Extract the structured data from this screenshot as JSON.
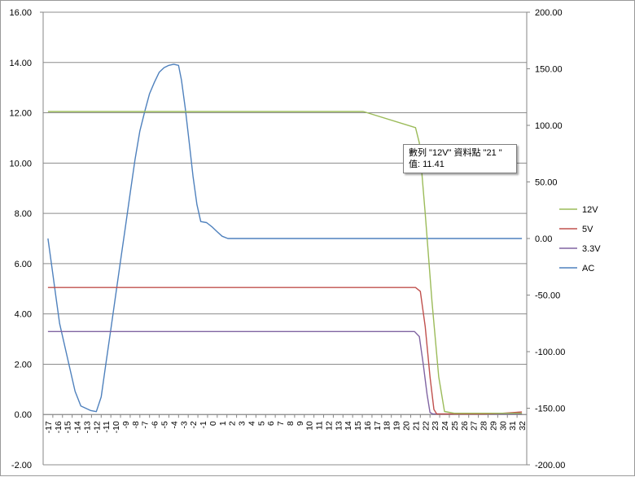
{
  "chart_data": {
    "type": "line",
    "title": "",
    "xlabel": "",
    "ylabel": "",
    "x_categories": [
      "-17",
      "-16",
      "-15",
      "-14",
      "-13",
      "-12",
      "-11",
      "-10",
      "-9",
      "-8",
      "-7",
      "-6",
      "-5",
      "-4",
      "-3",
      "-2",
      "-1",
      "0",
      "1",
      "2",
      "3",
      "4",
      "5",
      "6",
      "7",
      "8",
      "9",
      "10",
      "11",
      "12",
      "13",
      "14",
      "15",
      "16",
      "17",
      "18",
      "19",
      "20",
      "21",
      "22",
      "23",
      "24",
      "25",
      "26",
      "27",
      "28",
      "29",
      "30",
      "31",
      "32"
    ],
    "y_primary": {
      "min": -2,
      "max": 16,
      "step": 2,
      "tick_labels": [
        "16.00",
        "14.00",
        "12.00",
        "10.00",
        "8.00",
        "6.00",
        "4.00",
        "2.00",
        "0.00",
        "-2.00"
      ]
    },
    "y_secondary": {
      "min": -200,
      "max": 200,
      "step": 50,
      "tick_labels": [
        "200.00",
        "150.00",
        "100.00",
        "50.00",
        "0.00",
        "-50.00",
        "-100.00",
        "-150.00",
        "-200.00"
      ]
    },
    "grid": "horizontal",
    "legend_position": "right",
    "series": [
      {
        "name": "12V",
        "axis": "primary",
        "color": "#9bbb59",
        "points": [
          [
            -17,
            12.05
          ],
          [
            15.6,
            12.05
          ],
          [
            21,
            11.41
          ],
          [
            21.4,
            10.8
          ],
          [
            22,
            8.0
          ],
          [
            22.7,
            4.5
          ],
          [
            23.4,
            1.5
          ],
          [
            24,
            0.12
          ],
          [
            25,
            0.05
          ],
          [
            32,
            0.05
          ]
        ]
      },
      {
        "name": "5V",
        "axis": "primary",
        "color": "#c0504d",
        "points": [
          [
            -17,
            5.05
          ],
          [
            21,
            5.05
          ],
          [
            21.5,
            4.9
          ],
          [
            22,
            3.5
          ],
          [
            22.5,
            1.5
          ],
          [
            22.9,
            0.2
          ],
          [
            23.2,
            0.02
          ],
          [
            28,
            0.02
          ],
          [
            30,
            0.05
          ],
          [
            32,
            0.1
          ]
        ]
      },
      {
        "name": "3.3V",
        "axis": "primary",
        "color": "#8064a2",
        "points": [
          [
            -17,
            3.3
          ],
          [
            20.9,
            3.3
          ],
          [
            21.4,
            3.1
          ],
          [
            21.8,
            2.0
          ],
          [
            22.2,
            0.8
          ],
          [
            22.5,
            0.08
          ],
          [
            22.8,
            0.02
          ],
          [
            32,
            0.02
          ]
        ]
      },
      {
        "name": "AC",
        "axis": "secondary",
        "color": "#4f81bd",
        "points": [
          [
            -17,
            0
          ],
          [
            -16.6,
            -25
          ],
          [
            -16.2,
            -50
          ],
          [
            -15.8,
            -75
          ],
          [
            -15,
            -105
          ],
          [
            -14.2,
            -135
          ],
          [
            -13.6,
            -148
          ],
          [
            -12.6,
            -152
          ],
          [
            -12,
            -153
          ],
          [
            -11.5,
            -140
          ],
          [
            -11,
            -110
          ],
          [
            -10.5,
            -80
          ],
          [
            -10,
            -50
          ],
          [
            -9.5,
            -20
          ],
          [
            -9,
            10
          ],
          [
            -8.5,
            40
          ],
          [
            -8,
            70
          ],
          [
            -7.5,
            95
          ],
          [
            -7,
            112
          ],
          [
            -6.5,
            128
          ],
          [
            -6,
            138
          ],
          [
            -5.5,
            147
          ],
          [
            -5,
            151
          ],
          [
            -4.5,
            153
          ],
          [
            -4,
            154
          ],
          [
            -3.5,
            153
          ],
          [
            -3.2,
            140
          ],
          [
            -2.8,
            115
          ],
          [
            -2.4,
            85
          ],
          [
            -2,
            55
          ],
          [
            -1.6,
            30
          ],
          [
            -1.2,
            15
          ],
          [
            -0.6,
            14
          ],
          [
            0,
            10
          ],
          [
            0.5,
            6
          ],
          [
            1,
            2
          ],
          [
            1.6,
            0
          ],
          [
            32,
            0
          ]
        ]
      }
    ],
    "tooltip": {
      "line1": "數列 \"12V\" 資料點 \"21 \"",
      "line2": "值: 11.41"
    }
  }
}
